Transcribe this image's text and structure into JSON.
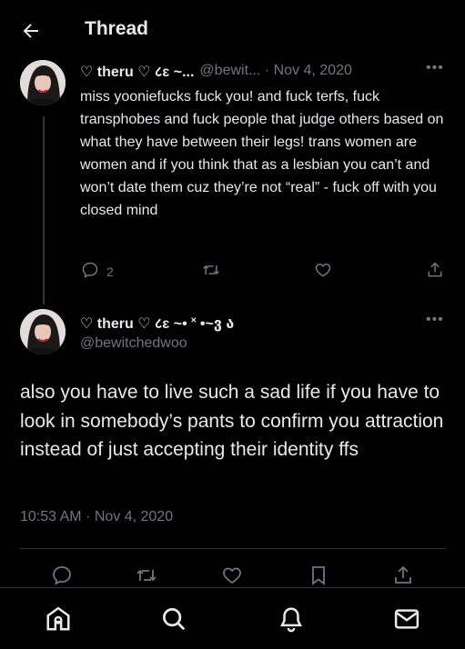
{
  "header": {
    "title": "Thread"
  },
  "reply_tweet": {
    "display_name": "♡ theru ♡ ८ɛ ~...",
    "handle": "@bewit...",
    "date_sep": " · ",
    "date": "Nov 4, 2020",
    "text": "miss yooniefucks fuck you! and fuck terfs, fuck transphobes and fuck people that judge others based on what they have between their legs! trans women are women and if you think that as a lesbian you can’t and won’t date them cuz they’re not “real” - fuck off with you closed mind",
    "reply_count": "2"
  },
  "main_tweet": {
    "display_name": "♡ theru ♡ ८ɛ ~• ˟ •~ვ ა",
    "handle": "@bewitchedwoo",
    "text": "also you have to live such a sad life if you have to look in somebody’s pants to confirm you attraction instead of just accepting their identity ffs",
    "timestamp": "10:53 AM · Nov 4, 2020"
  },
  "more_label": "•••",
  "icons": {
    "back": "arrow-left-icon",
    "reply": "reply-icon",
    "retweet": "retweet-icon",
    "like": "heart-icon",
    "bookmark": "bookmark-icon",
    "share": "share-icon",
    "home": "home-icon",
    "search": "search-icon",
    "notifications": "bell-icon",
    "messages": "mail-icon"
  },
  "colors": {
    "background": "#000000",
    "text": "#e7e9ea",
    "muted": "#71767b",
    "divider": "#2f3336"
  }
}
